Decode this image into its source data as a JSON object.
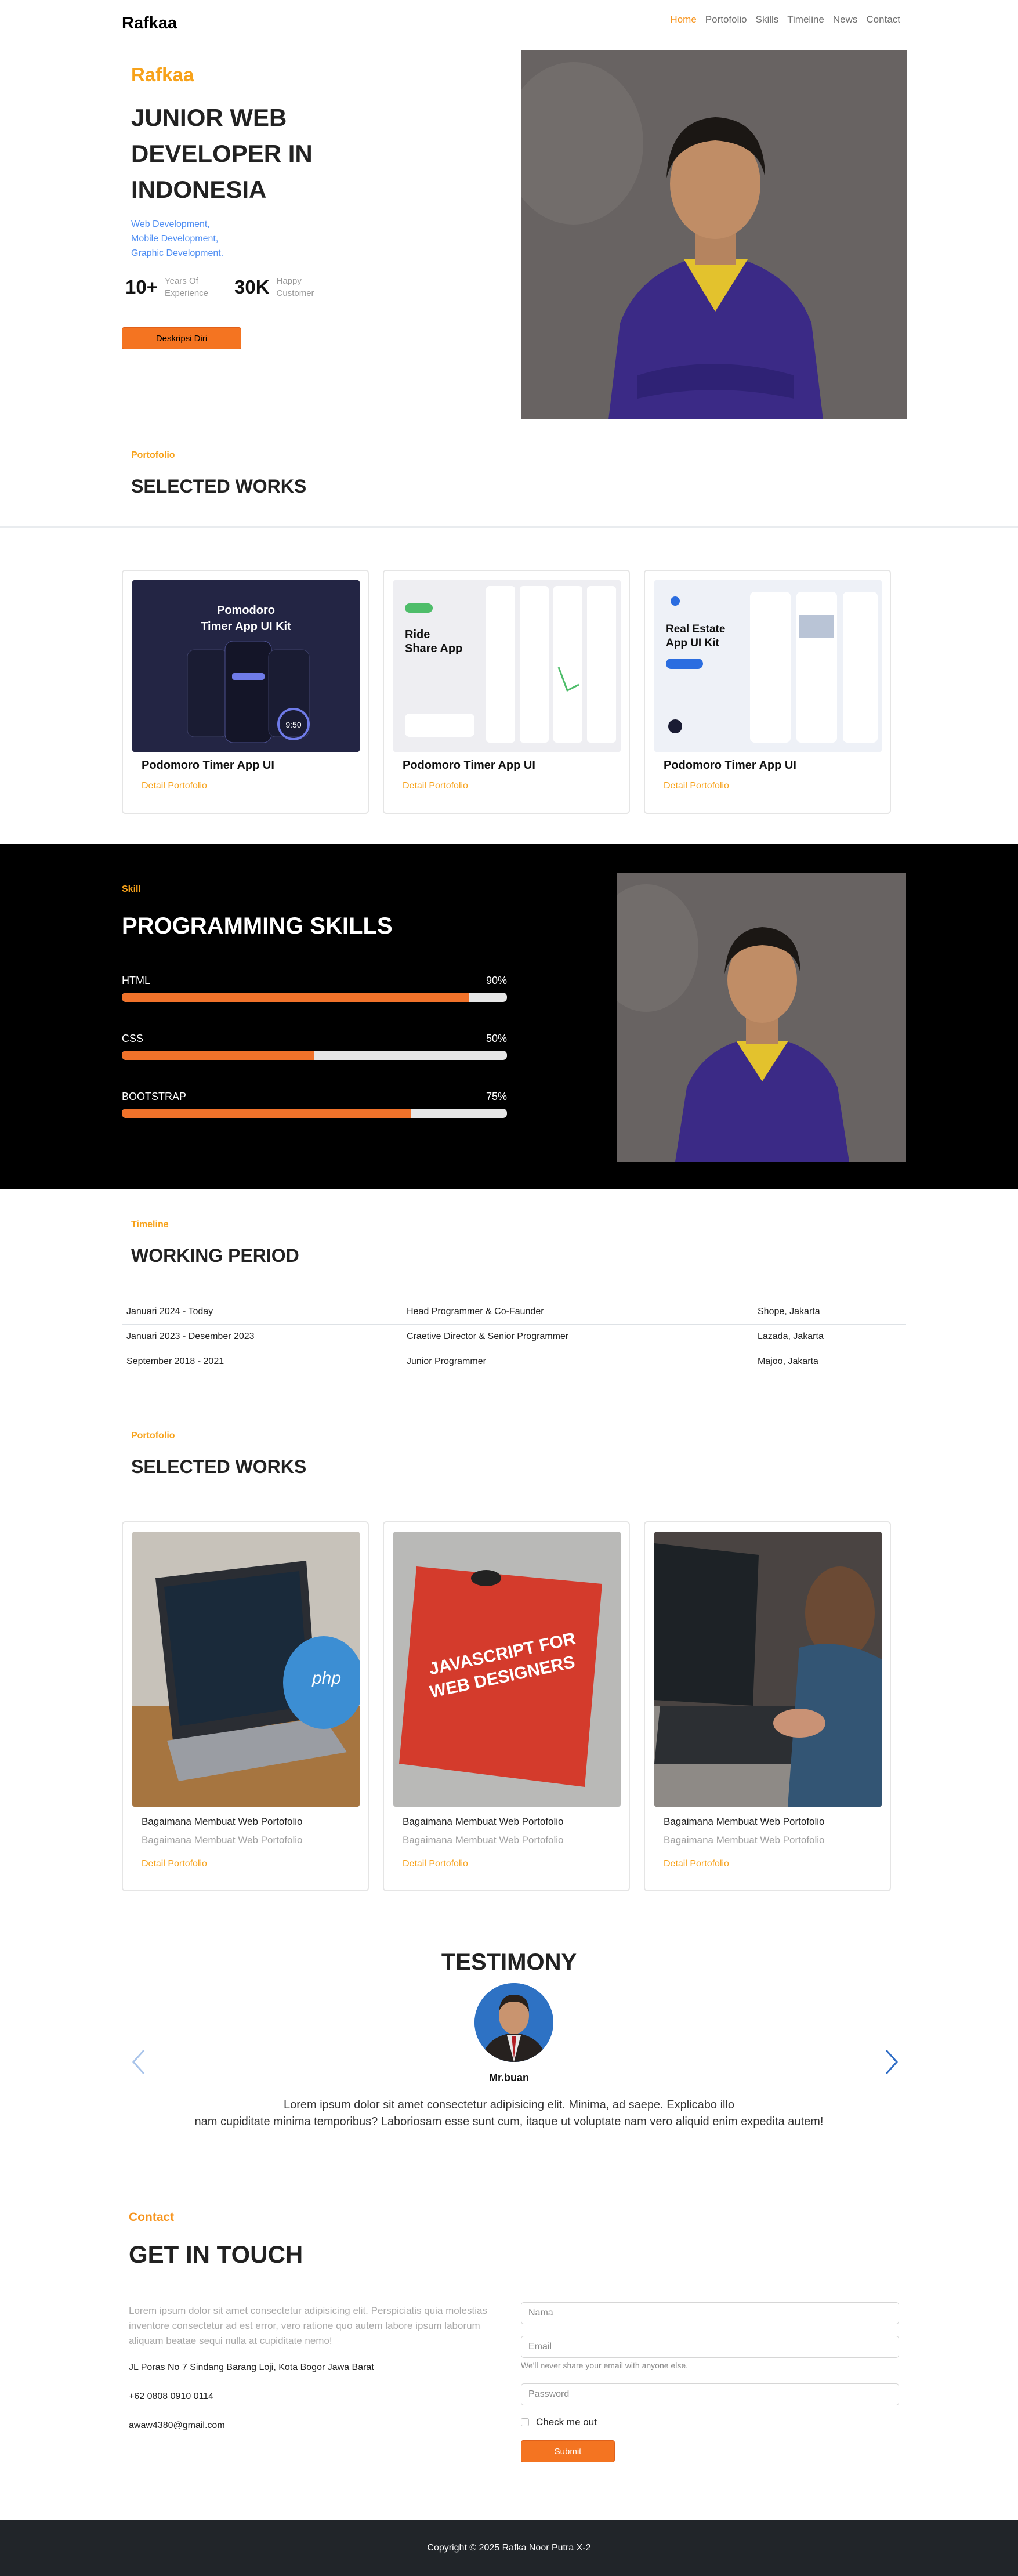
{
  "nav": {
    "brand": "Rafkaa",
    "items": [
      {
        "label": "Home",
        "active": true
      },
      {
        "label": "Portofolio",
        "active": false
      },
      {
        "label": "Skills",
        "active": false
      },
      {
        "label": "Timeline",
        "active": false
      },
      {
        "label": "News",
        "active": false
      },
      {
        "label": "Contact",
        "active": false
      }
    ]
  },
  "hero": {
    "name": "Rafkaa",
    "title": "Junior Web Developer in Indonesia",
    "links": [
      "Web Development,",
      "Mobile Development,",
      "Graphic Development."
    ],
    "stats": [
      {
        "value": "10+",
        "label": "Years Of Experience"
      },
      {
        "value": "30K",
        "label": "Happy Customer"
      }
    ],
    "button": "Deskripsi Diri"
  },
  "works": {
    "eyebrow": "Portofolio",
    "title": "Selected Works",
    "cards": [
      {
        "title": "Podomoro Timer App UI",
        "link": "Detail Portofolio",
        "image_heading": "Pomodoro Timer App UI  Kit"
      },
      {
        "title": "Podomoro Timer App UI",
        "link": "Detail Portofolio",
        "image_heading": "Ride Share App"
      },
      {
        "title": "Podomoro Timer App UI",
        "link": "Detail Portofolio",
        "image_heading": "Real Estate App UI Kit"
      }
    ]
  },
  "skills": {
    "eyebrow": "Skill",
    "title": "Programming Skills",
    "items": [
      {
        "name": "HTML",
        "percent_label": "90%",
        "value": 90
      },
      {
        "name": "CSS",
        "percent_label": "50%",
        "value": 50
      },
      {
        "name": "BOOTSTRAP",
        "percent_label": "75%",
        "value": 75
      }
    ]
  },
  "timeline": {
    "eyebrow": "Timeline",
    "title": "Working Period",
    "rows": [
      {
        "period": "Januari 2024 - Today",
        "role": "Head Programmer & Co-Faunder",
        "place": "Shope, Jakarta"
      },
      {
        "period": "Januari 2023 - Desember 2023",
        "role": "Craetive Director & Senior Programmer",
        "place": "Lazada, Jakarta"
      },
      {
        "period": "September 2018 - 2021",
        "role": "Junior Programmer",
        "place": "Majoo, Jakarta"
      }
    ]
  },
  "blog": {
    "eyebrow": "Portofolio",
    "title": "Selected Works",
    "cards": [
      {
        "title": "Bagaimana Membuat Web Portofolio",
        "subtitle": "Bagaimana Membuat Web Portofolio",
        "link": "Detail Portofolio",
        "image_text": "php"
      },
      {
        "title": "Bagaimana Membuat Web Portofolio",
        "subtitle": "Bagaimana Membuat Web Portofolio",
        "link": "Detail Portofolio",
        "image_text": "JAVASCRIPT FOR WEB DESIGNERS"
      },
      {
        "title": "Bagaimana Membuat Web Portofolio",
        "subtitle": "Bagaimana Membuat Web Portofolio",
        "link": "Detail Portofolio",
        "image_text": ""
      }
    ]
  },
  "testimony": {
    "title": "TESTIMONY",
    "name": "Mr.buan",
    "line1": "Lorem ipsum dolor sit amet consectetur adipisicing elit. Minima, ad saepe. Explicabo illo",
    "line2": "nam cupiditate minima temporibus? Laboriosam esse sunt cum, itaque ut voluptate nam vero aliquid enim expedita autem!"
  },
  "contact": {
    "eyebrow": "Contact",
    "title": "Get In Touch",
    "text": "Lorem ipsum dolor sit amet consectetur adipisicing elit. Perspiciatis quia molestias inventore consectetur ad est error, vero ratione quo autem labore ipsum laborum aliquam beatae sequi nulla at cupiditate nemo!",
    "address": "JL Poras No 7 Sindang Barang Loji, Kota Bogor Jawa Barat",
    "phone": "+62 0808 0910 0114",
    "email": "awaw4380@gmail.com",
    "form": {
      "name_placeholder": "Nama",
      "email_placeholder": "Email",
      "email_hint": "We'll never share your email with anyone else.",
      "password_placeholder": "Password",
      "checkbox_label": "Check me out",
      "submit": "Submit"
    }
  },
  "footer": {
    "text": "Copyright © 2025 Rafka Noor Putra X-2"
  },
  "colors": {
    "accent": "#f7a21a",
    "button": "#f47421",
    "link": "#4f8ef3",
    "dark": "#000000",
    "footer": "#212529"
  }
}
